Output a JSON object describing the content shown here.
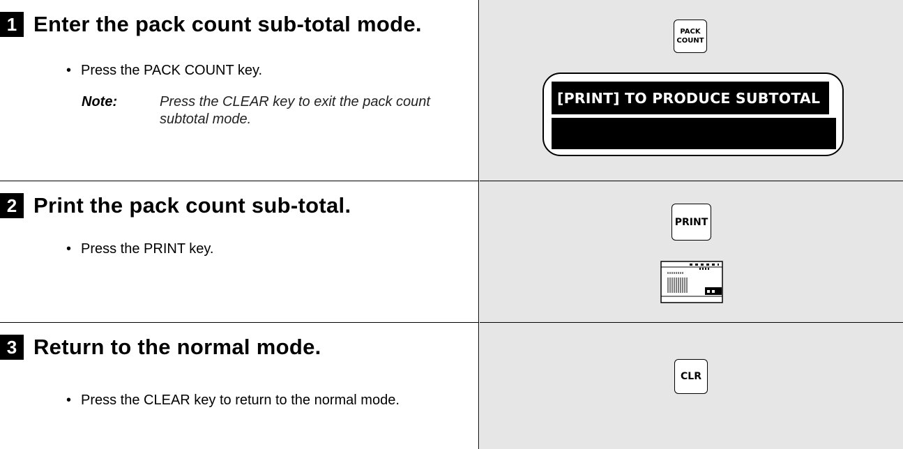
{
  "steps": [
    {
      "number": "1",
      "title": "Enter the pack count sub-total mode.",
      "bullet": "Press the PACK COUNT key.",
      "note_label": "Note:",
      "note_text": "Press the CLEAR key to exit the pack count subtotal mode.",
      "key_label": "PACK COUNT",
      "display_line1": "[PRINT] TO PRODUCE SUBTOTAL",
      "display_line2": ""
    },
    {
      "number": "2",
      "title": "Print the pack count sub-total.",
      "bullet": "Press the PRINT key.",
      "key_label": "PRINT",
      "printer_icon": "printer-icon"
    },
    {
      "number": "3",
      "title": "Return to the normal mode.",
      "bullet": "Press the CLEAR key to return to the normal mode.",
      "key_label": "CLR"
    }
  ],
  "colors": {
    "panel_background": "#e6e6e6",
    "step_number_background": "#000000",
    "display_background": "#000000"
  }
}
